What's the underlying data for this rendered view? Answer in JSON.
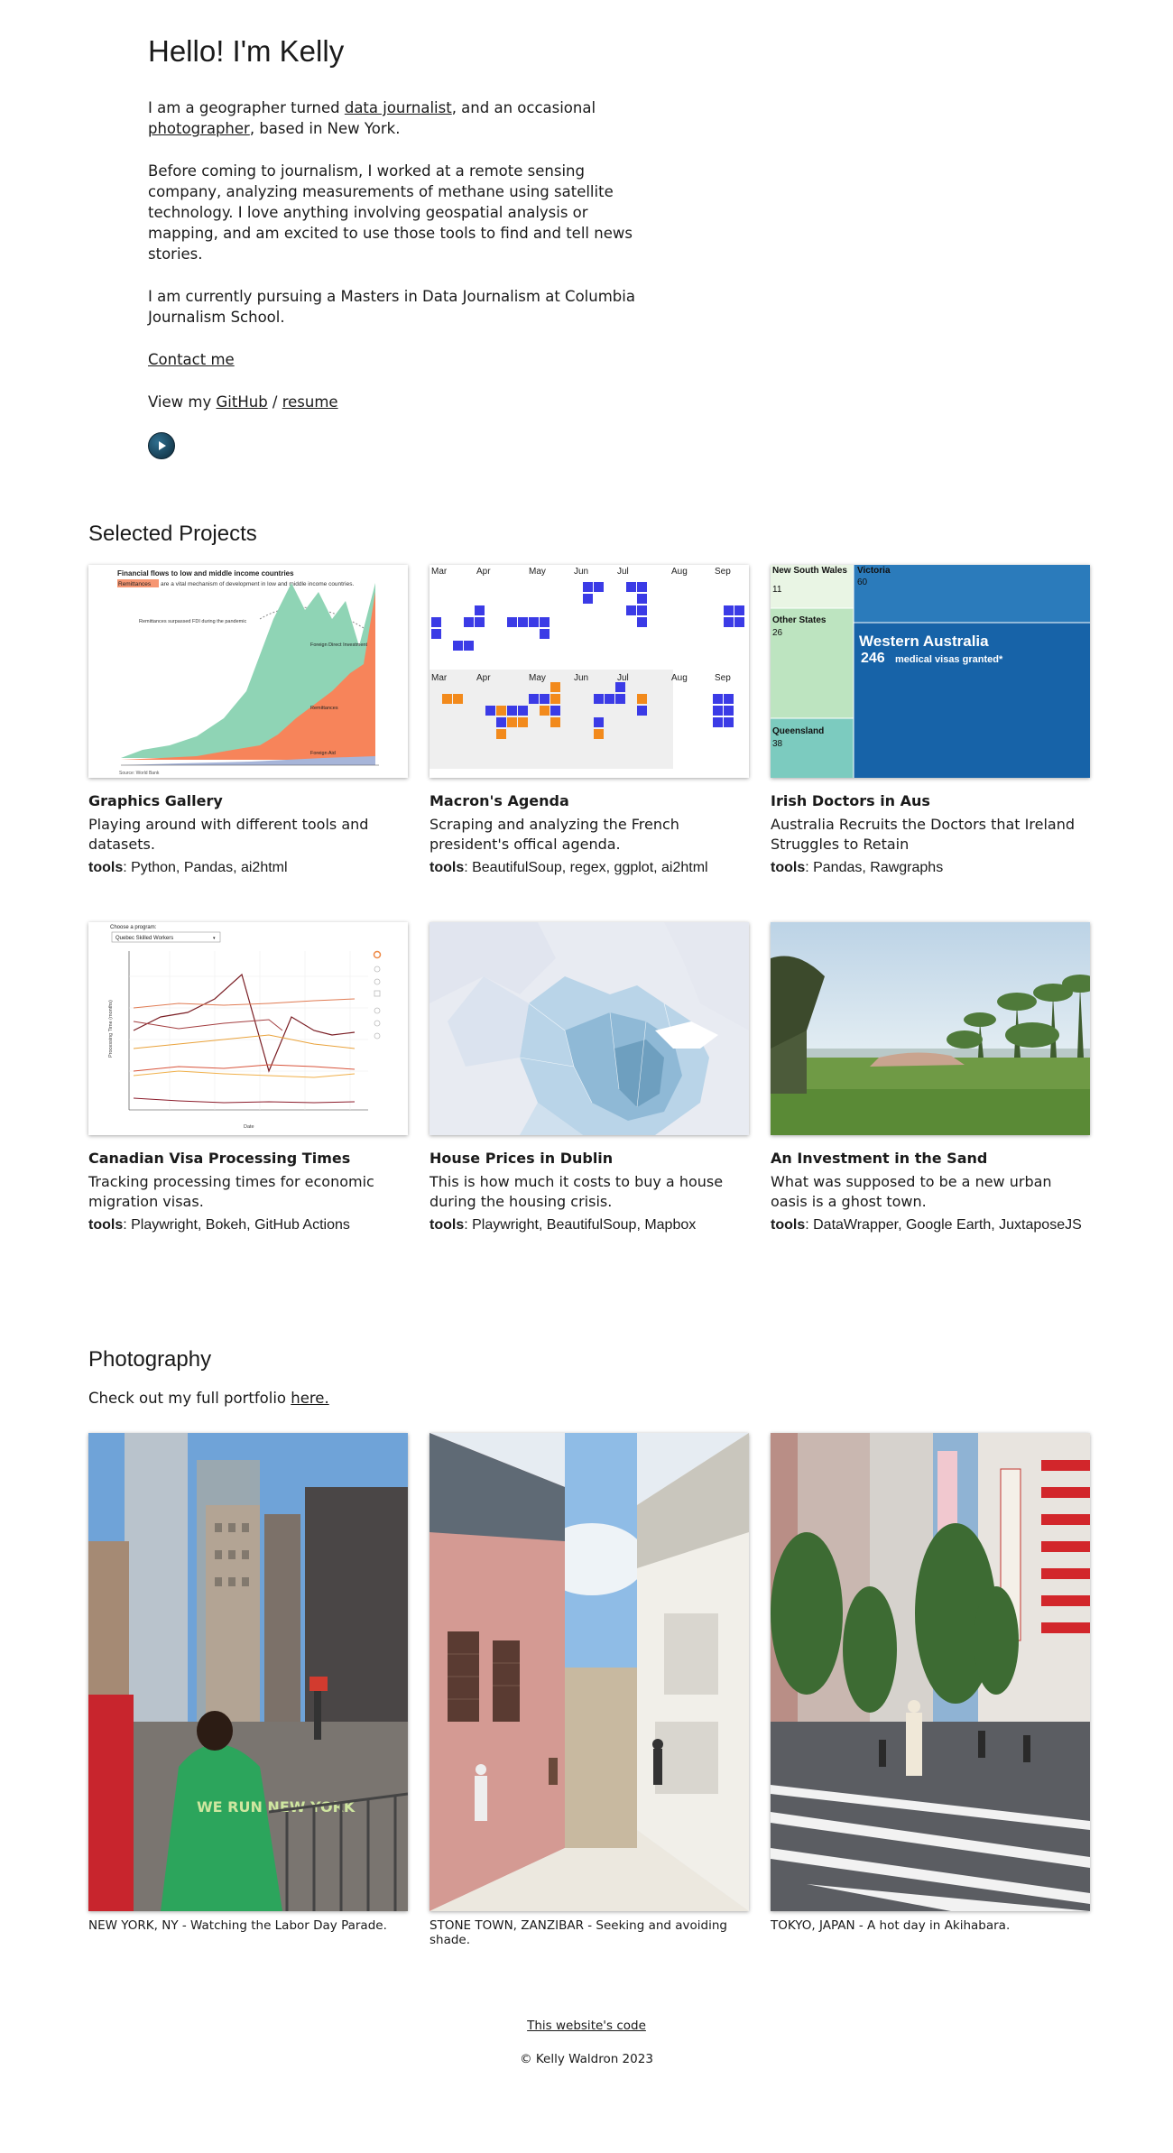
{
  "intro": {
    "heading": "Hello! I'm Kelly",
    "p1_a": "I am a geographer turned ",
    "p1_link1": "data journalist",
    "p1_b": ", and an occasional ",
    "p1_link2": "photographer",
    "p1_c": ", based in New York.",
    "p2": "Before coming to journalism, I worked at a remote sensing company, analyzing measurements of methane using satellite technology. I love anything involving geospatial analysis or mapping, and am excited to use those tools to find and tell news stories.",
    "p3": "I am currently pursuing a Masters in Data Journalism at Columbia Journalism School.",
    "contact": "Contact me",
    "view_prefix": "View my ",
    "github": "GitHub",
    "sep": " / ",
    "resume": "resume"
  },
  "projects": {
    "title": "Selected Projects",
    "tools_label": "tools",
    "items": [
      {
        "title": "Graphics Gallery",
        "desc": "Playing around with different tools and datasets.",
        "tools": ": Python, Pandas, ai2html",
        "thumb": {
          "heading": "Financial flows to low and middle income countries",
          "sub_highlight": "Remittances",
          "sub_rest": " are a vital mechanism of development in low and middle income countries.",
          "note": "Remittances surpassed FDI during the pandemic",
          "label_fdi": "Foreign Direct Investment",
          "label_rem": "Remittances",
          "label_aid": "Foreign Aid",
          "source": "Source: World Bank"
        }
      },
      {
        "title": "Macron's Agenda",
        "desc": "Scraping and analyzing the French president's offical agenda.",
        "tools": ": BeautifulSoup, regex, ggplot, ai2html",
        "thumb": {
          "months": [
            "Mar",
            "Apr",
            "May",
            "Jun",
            "Jul",
            "Aug",
            "Sep"
          ]
        }
      },
      {
        "title": "Irish Doctors in Aus",
        "desc": "Australia Recruits the Doctors that Ireland Struggles to Retain",
        "tools": ": Pandas, Rawgraphs",
        "thumb": {
          "nsw": "New South Wales",
          "nsw_val": "11",
          "vic": "Victoria",
          "vic_val": "60",
          "other": "Other States",
          "other_val": "26",
          "qld": "Queensland",
          "qld_val": "38",
          "wa": "Western Australia",
          "wa_val": "246",
          "wa_note": "medical visas granted*"
        }
      },
      {
        "title": "Canadian Visa Processing Times",
        "desc": "Tracking processing times for economic migration visas.",
        "tools": ": Playwright, Bokeh, GitHub Actions",
        "thumb": {
          "choose": "Choose a program:",
          "select": "Quebec Skilled Workers",
          "xlabel": "Date",
          "ylabel": "Processing Time (months)"
        }
      },
      {
        "title": "House Prices in Dublin",
        "desc": "This is how much it costs to buy a house during the housing crisis.",
        "tools": ": Playwright, BeautifulSoup, Mapbox",
        "thumb": {}
      },
      {
        "title": "An Investment in the Sand",
        "desc": "What was supposed to be a new urban oasis is a ghost town.",
        "tools": ": DataWrapper, Google Earth, JuxtaposeJS",
        "thumb": {}
      }
    ]
  },
  "photography": {
    "title": "Photography",
    "portfolio_prefix": "Check out my full portfolio ",
    "portfolio_link": "here.",
    "photos": [
      {
        "caption": "NEW YORK, NY - Watching the Labor Day Parade.",
        "shirt": "WE RUN NEW YORK"
      },
      {
        "caption": "STONE TOWN, ZANZIBAR - Seeking and avoiding shade."
      },
      {
        "caption": "TOKYO, JAPAN - A hot day in Akihabara."
      }
    ]
  },
  "footer": {
    "code_link": "This website's code",
    "copyright": "© Kelly Waldron 2023"
  }
}
